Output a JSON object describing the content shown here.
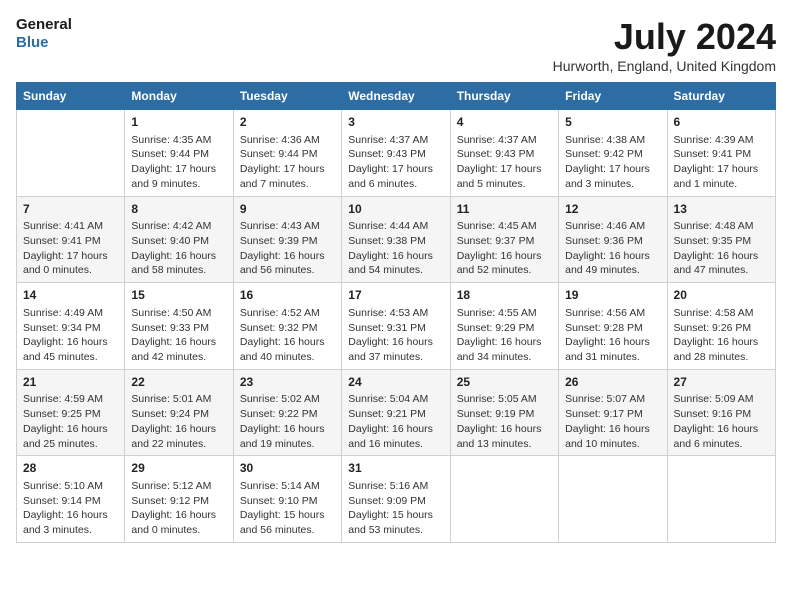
{
  "header": {
    "logo_line1": "General",
    "logo_line2": "Blue",
    "month": "July 2024",
    "location": "Hurworth, England, United Kingdom"
  },
  "days_of_week": [
    "Sunday",
    "Monday",
    "Tuesday",
    "Wednesday",
    "Thursday",
    "Friday",
    "Saturday"
  ],
  "weeks": [
    [
      {
        "day": "",
        "info": ""
      },
      {
        "day": "1",
        "info": "Sunrise: 4:35 AM\nSunset: 9:44 PM\nDaylight: 17 hours\nand 9 minutes."
      },
      {
        "day": "2",
        "info": "Sunrise: 4:36 AM\nSunset: 9:44 PM\nDaylight: 17 hours\nand 7 minutes."
      },
      {
        "day": "3",
        "info": "Sunrise: 4:37 AM\nSunset: 9:43 PM\nDaylight: 17 hours\nand 6 minutes."
      },
      {
        "day": "4",
        "info": "Sunrise: 4:37 AM\nSunset: 9:43 PM\nDaylight: 17 hours\nand 5 minutes."
      },
      {
        "day": "5",
        "info": "Sunrise: 4:38 AM\nSunset: 9:42 PM\nDaylight: 17 hours\nand 3 minutes."
      },
      {
        "day": "6",
        "info": "Sunrise: 4:39 AM\nSunset: 9:41 PM\nDaylight: 17 hours\nand 1 minute."
      }
    ],
    [
      {
        "day": "7",
        "info": "Sunrise: 4:41 AM\nSunset: 9:41 PM\nDaylight: 17 hours\nand 0 minutes."
      },
      {
        "day": "8",
        "info": "Sunrise: 4:42 AM\nSunset: 9:40 PM\nDaylight: 16 hours\nand 58 minutes."
      },
      {
        "day": "9",
        "info": "Sunrise: 4:43 AM\nSunset: 9:39 PM\nDaylight: 16 hours\nand 56 minutes."
      },
      {
        "day": "10",
        "info": "Sunrise: 4:44 AM\nSunset: 9:38 PM\nDaylight: 16 hours\nand 54 minutes."
      },
      {
        "day": "11",
        "info": "Sunrise: 4:45 AM\nSunset: 9:37 PM\nDaylight: 16 hours\nand 52 minutes."
      },
      {
        "day": "12",
        "info": "Sunrise: 4:46 AM\nSunset: 9:36 PM\nDaylight: 16 hours\nand 49 minutes."
      },
      {
        "day": "13",
        "info": "Sunrise: 4:48 AM\nSunset: 9:35 PM\nDaylight: 16 hours\nand 47 minutes."
      }
    ],
    [
      {
        "day": "14",
        "info": "Sunrise: 4:49 AM\nSunset: 9:34 PM\nDaylight: 16 hours\nand 45 minutes."
      },
      {
        "day": "15",
        "info": "Sunrise: 4:50 AM\nSunset: 9:33 PM\nDaylight: 16 hours\nand 42 minutes."
      },
      {
        "day": "16",
        "info": "Sunrise: 4:52 AM\nSunset: 9:32 PM\nDaylight: 16 hours\nand 40 minutes."
      },
      {
        "day": "17",
        "info": "Sunrise: 4:53 AM\nSunset: 9:31 PM\nDaylight: 16 hours\nand 37 minutes."
      },
      {
        "day": "18",
        "info": "Sunrise: 4:55 AM\nSunset: 9:29 PM\nDaylight: 16 hours\nand 34 minutes."
      },
      {
        "day": "19",
        "info": "Sunrise: 4:56 AM\nSunset: 9:28 PM\nDaylight: 16 hours\nand 31 minutes."
      },
      {
        "day": "20",
        "info": "Sunrise: 4:58 AM\nSunset: 9:26 PM\nDaylight: 16 hours\nand 28 minutes."
      }
    ],
    [
      {
        "day": "21",
        "info": "Sunrise: 4:59 AM\nSunset: 9:25 PM\nDaylight: 16 hours\nand 25 minutes."
      },
      {
        "day": "22",
        "info": "Sunrise: 5:01 AM\nSunset: 9:24 PM\nDaylight: 16 hours\nand 22 minutes."
      },
      {
        "day": "23",
        "info": "Sunrise: 5:02 AM\nSunset: 9:22 PM\nDaylight: 16 hours\nand 19 minutes."
      },
      {
        "day": "24",
        "info": "Sunrise: 5:04 AM\nSunset: 9:21 PM\nDaylight: 16 hours\nand 16 minutes."
      },
      {
        "day": "25",
        "info": "Sunrise: 5:05 AM\nSunset: 9:19 PM\nDaylight: 16 hours\nand 13 minutes."
      },
      {
        "day": "26",
        "info": "Sunrise: 5:07 AM\nSunset: 9:17 PM\nDaylight: 16 hours\nand 10 minutes."
      },
      {
        "day": "27",
        "info": "Sunrise: 5:09 AM\nSunset: 9:16 PM\nDaylight: 16 hours\nand 6 minutes."
      }
    ],
    [
      {
        "day": "28",
        "info": "Sunrise: 5:10 AM\nSunset: 9:14 PM\nDaylight: 16 hours\nand 3 minutes."
      },
      {
        "day": "29",
        "info": "Sunrise: 5:12 AM\nSunset: 9:12 PM\nDaylight: 16 hours\nand 0 minutes."
      },
      {
        "day": "30",
        "info": "Sunrise: 5:14 AM\nSunset: 9:10 PM\nDaylight: 15 hours\nand 56 minutes."
      },
      {
        "day": "31",
        "info": "Sunrise: 5:16 AM\nSunset: 9:09 PM\nDaylight: 15 hours\nand 53 minutes."
      },
      {
        "day": "",
        "info": ""
      },
      {
        "day": "",
        "info": ""
      },
      {
        "day": "",
        "info": ""
      }
    ]
  ]
}
